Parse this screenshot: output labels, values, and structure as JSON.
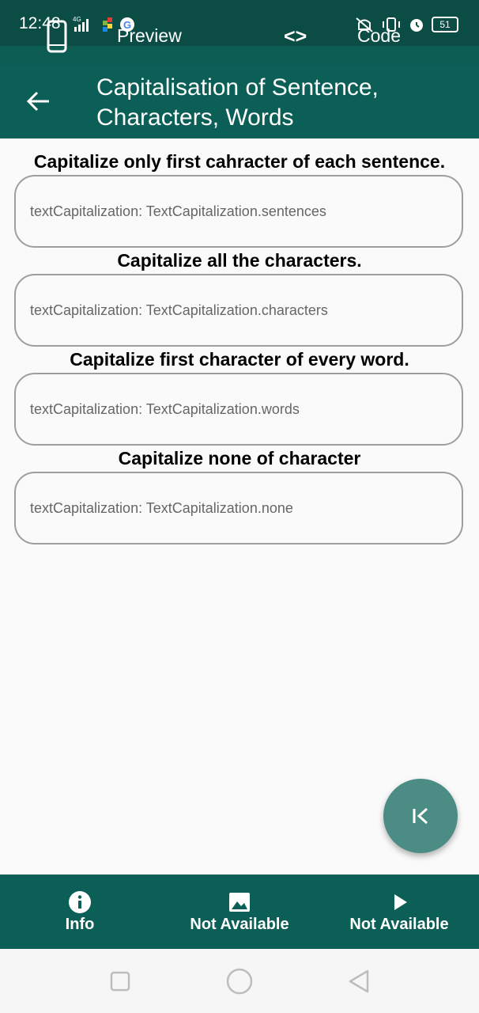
{
  "status_bar": {
    "time": "12:48",
    "network": "4G",
    "battery": "51"
  },
  "top_tabs": {
    "preview_label": "Preview",
    "code_icon": "<>",
    "code_label": "Code"
  },
  "app_bar": {
    "title": "Capitalisation of Sentence, Characters, Words",
    "back_icon": "arrow-left-icon"
  },
  "sections": [
    {
      "label": "Capitalize only first cahracter of each sentence.",
      "field_text": "textCapitalization: TextCapitalization.sentences"
    },
    {
      "label": "Capitalize all the characters.",
      "field_text": "textCapitalization: TextCapitalization.characters"
    },
    {
      "label": "Capitalize first character of every word.",
      "field_text": "textCapitalization: TextCapitalization.words"
    },
    {
      "label": "Capitalize none of character",
      "field_text": "textCapitalization: TextCapitalization.none"
    }
  ],
  "fab": {
    "icon": "first-page-icon"
  },
  "bottom_nav": {
    "items": [
      {
        "label": "Info",
        "icon": "info-icon"
      },
      {
        "label": "Not Available",
        "icon": "image-icon"
      },
      {
        "label": "Not Available",
        "icon": "play-icon"
      }
    ]
  },
  "colors": {
    "primary": "#0b5f56",
    "status": "#0b4d45",
    "fab": "#4b8c85",
    "background": "#fafafa"
  }
}
